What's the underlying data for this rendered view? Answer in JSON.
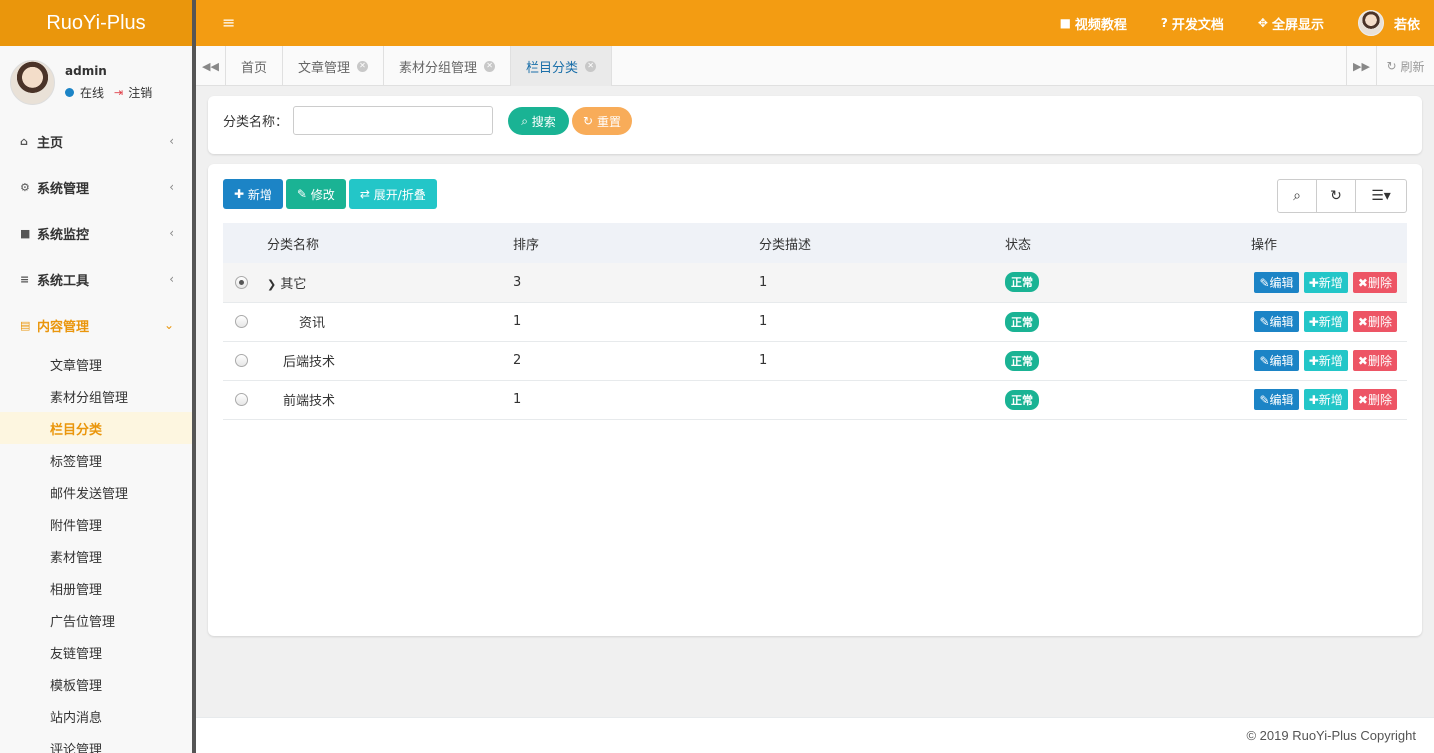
{
  "app": {
    "logo": "RuoYi-Plus"
  },
  "user": {
    "name": "admin",
    "status": "在线",
    "logout": "注销",
    "nickname": "若依"
  },
  "header": {
    "links": [
      {
        "icon": "video-icon",
        "glyph": "■",
        "label": "视频教程"
      },
      {
        "icon": "question-icon",
        "glyph": "?",
        "label": "开发文档"
      },
      {
        "icon": "fullscreen-icon",
        "glyph": "✥",
        "label": "全屏显示"
      }
    ]
  },
  "sidebar": {
    "menus": [
      {
        "icon": "home-icon",
        "glyph": "⌂",
        "label": "主页"
      },
      {
        "icon": "gear-icon",
        "glyph": "⚙",
        "label": "系统管理"
      },
      {
        "icon": "camera-icon",
        "glyph": "■",
        "label": "系统监控"
      },
      {
        "icon": "bars-icon",
        "glyph": "≡",
        "label": "系统工具"
      }
    ],
    "content_menu": {
      "icon": "id-card-icon",
      "glyph": "▤",
      "label": "内容管理"
    },
    "content_items": [
      "文章管理",
      "素材分组管理",
      "栏目分类",
      "标签管理",
      "邮件发送管理",
      "附件管理",
      "素材管理",
      "相册管理",
      "广告位管理",
      "友链管理",
      "模板管理",
      "站内消息",
      "评论管理"
    ]
  },
  "tabs": {
    "items": [
      "首页",
      "文章管理",
      "素材分组管理",
      "栏目分类"
    ],
    "refresh": "刷新"
  },
  "search": {
    "label": "分类名称：",
    "value": "",
    "search_button": "搜索",
    "reset_button": "重置"
  },
  "toolbar": {
    "add": "新增",
    "edit": "修改",
    "toggle": "展开/折叠"
  },
  "table": {
    "columns": [
      "分类名称",
      "排序",
      "分类描述",
      "状态",
      "操作"
    ],
    "rows": [
      {
        "name": "其它",
        "sort": "3",
        "desc": "1",
        "status": "正常"
      },
      {
        "name": "资讯",
        "sort": "1",
        "desc": "1",
        "status": "正常"
      },
      {
        "name": "后端技术",
        "sort": "2",
        "desc": "1",
        "status": "正常"
      },
      {
        "name": "前端技术",
        "sort": "1",
        "desc": "",
        "status": "正常"
      }
    ],
    "actions": {
      "edit": "编辑",
      "add": "新增",
      "delete": "删除"
    }
  },
  "footer": {
    "copyright": "© 2019 RuoYi-Plus Copyright"
  },
  "colors": {
    "header": "#f39c12",
    "logo_bg": "#ea960c",
    "primary": "#1c84c6",
    "success": "#1ab394",
    "info": "#23c6c8",
    "danger": "#ed5565",
    "warning": "#f8ac59"
  }
}
